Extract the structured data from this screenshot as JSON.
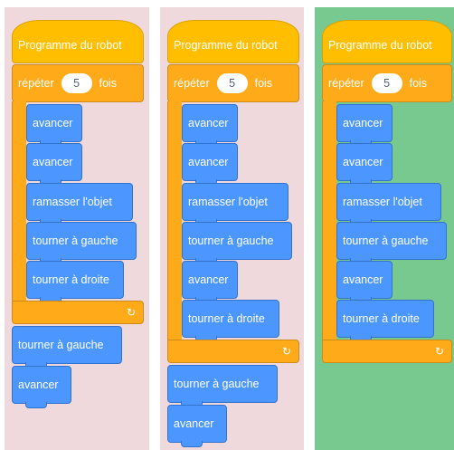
{
  "hat_label": "Programme du robot",
  "repeat": {
    "label": "répéter",
    "count": "5",
    "suffix": "fois",
    "loop_icon": "↻"
  },
  "panels": [
    {
      "status": "incorrect",
      "color": "#f0d9dc",
      "inner": [
        "avancer",
        "avancer",
        "ramasser l'objet",
        "tourner à gauche",
        "tourner à droite"
      ],
      "after": [
        "tourner à gauche",
        "avancer"
      ]
    },
    {
      "status": "incorrect",
      "color": "#f0d9dc",
      "inner": [
        "avancer",
        "avancer",
        "ramasser l'objet",
        "tourner à gauche",
        "avancer",
        "tourner à droite"
      ],
      "after": [
        "tourner à gauche",
        "avancer"
      ]
    },
    {
      "status": "correct",
      "color": "#77c98f",
      "inner": [
        "avancer",
        "avancer",
        "ramasser l'objet",
        "tourner à gauche",
        "avancer",
        "tourner à droite"
      ],
      "after": []
    }
  ]
}
